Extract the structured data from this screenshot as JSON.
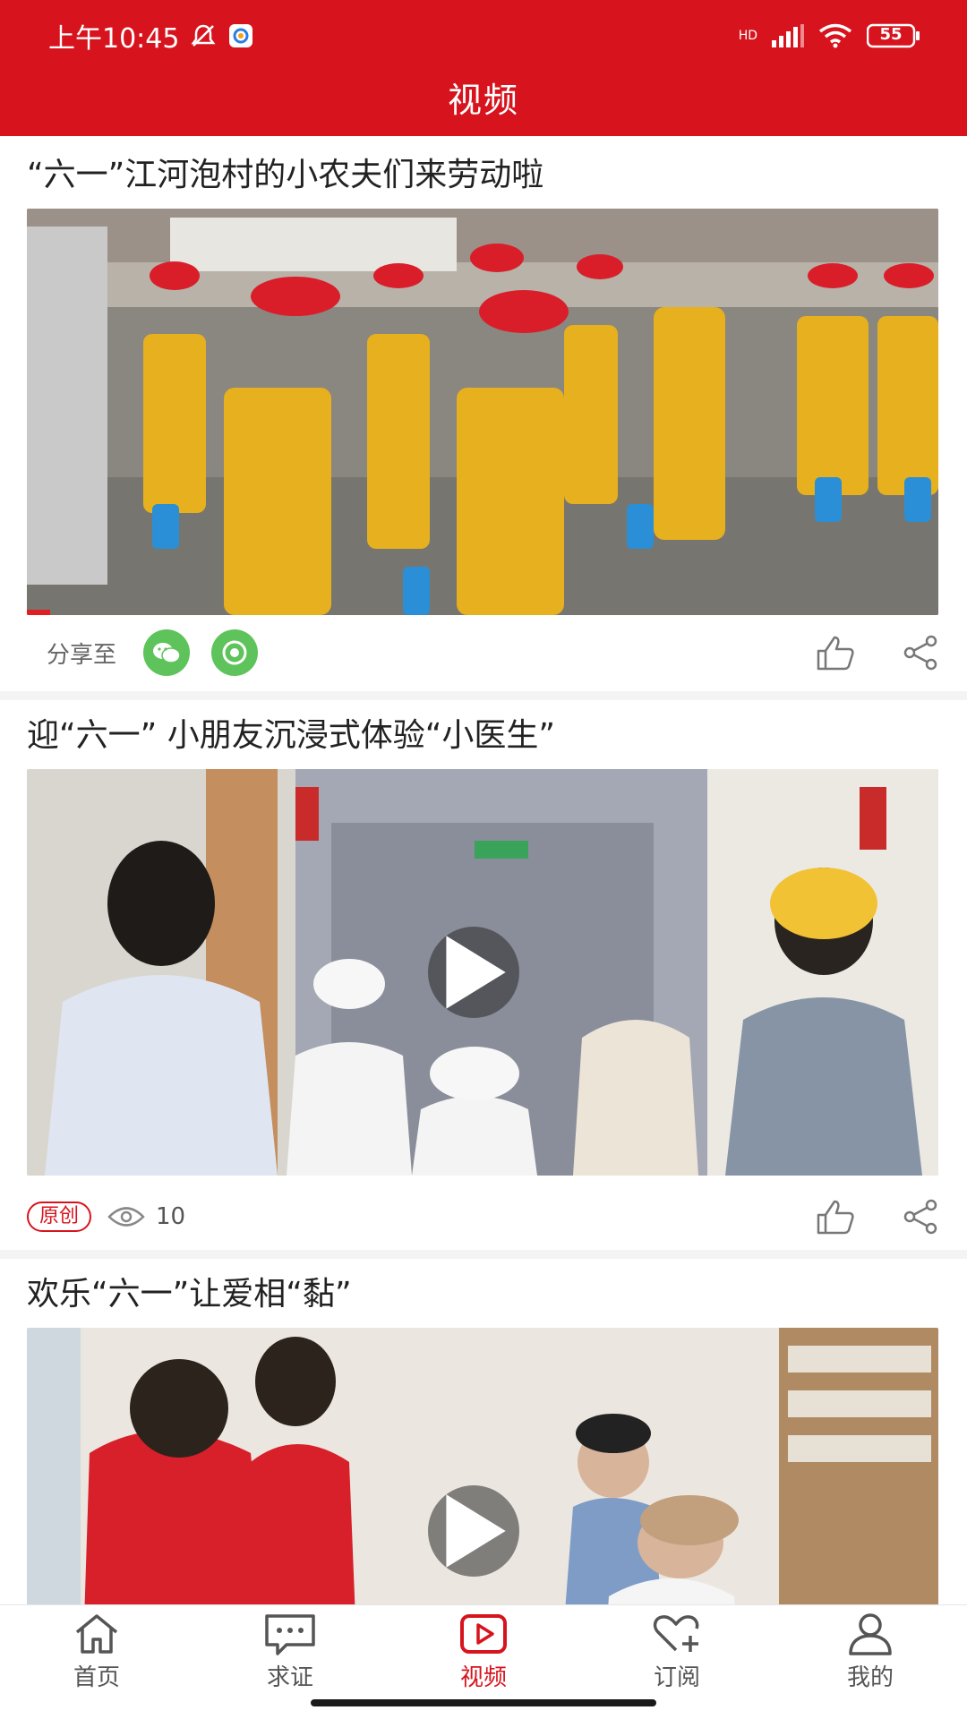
{
  "status_bar": {
    "time": "上午10:45",
    "battery": "55",
    "network": "HD"
  },
  "header": {
    "title": "视频"
  },
  "feed": [
    {
      "title": "“六一”江河泡村的小农夫们来劳动啦",
      "share_label": "分享至"
    },
    {
      "title": "迎“六一” 小朋友沉浸式体验“小医生”",
      "badge": "原创",
      "views": "10"
    },
    {
      "title": "欢乐“六一”让爱相“黏”"
    }
  ],
  "bottom_nav": [
    {
      "label": "首页",
      "icon": "home-icon"
    },
    {
      "label": "求证",
      "icon": "chat-bubble-icon"
    },
    {
      "label": "视频",
      "icon": "video-play-icon",
      "active": true
    },
    {
      "label": "订阅",
      "icon": "heart-plus-icon"
    },
    {
      "label": "我的",
      "icon": "user-icon"
    }
  ],
  "colors": {
    "brand_red": "#d7141e",
    "share_green": "#5ec35a"
  }
}
